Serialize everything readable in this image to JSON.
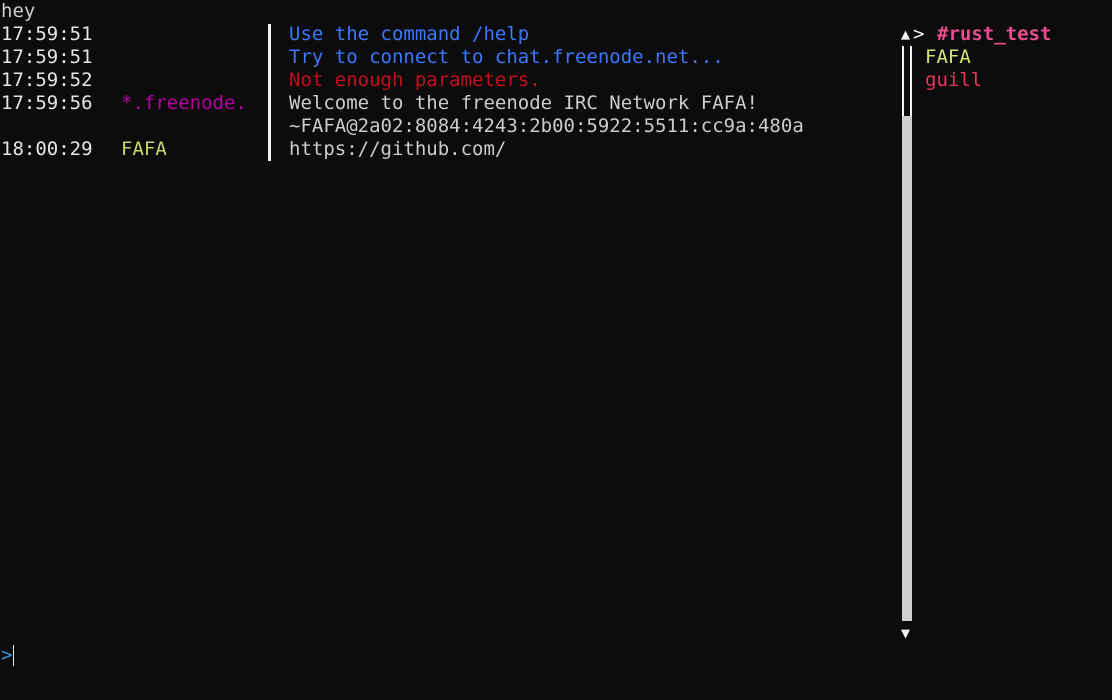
{
  "top_line": "hey",
  "messages": [
    {
      "time": "17:59:51",
      "nick": "",
      "nick_color": "#cccccc",
      "text": "Use the command /help",
      "text_color": "#3b78ff"
    },
    {
      "time": "17:59:51",
      "nick": "",
      "nick_color": "#cccccc",
      "text": "Try to connect to chat.freenode.net...",
      "text_color": "#3b78ff"
    },
    {
      "time": "17:59:52",
      "nick": "",
      "nick_color": "#cccccc",
      "text": "Not enough parameters.",
      "text_color": "#c50f1f"
    },
    {
      "time": "17:59:56",
      "nick": "*.freenode.",
      "nick_color": "#b4009e",
      "text": "Welcome to the freenode IRC Network FAFA!",
      "text_color": "#cccccc"
    },
    {
      "time": "",
      "nick": "",
      "nick_color": "#cccccc",
      "text": "~FAFA@2a02:8084:4243:2b00:5922:5511:cc9a:480a",
      "text_color": "#cccccc"
    },
    {
      "time": "18:00:29",
      "nick": "FAFA",
      "nick_color": "#c8d86a",
      "text": "https://github.com/",
      "text_color": "#cccccc"
    }
  ],
  "channel_panel": {
    "scroll_up_glyph": "▲",
    "selector": ">",
    "channel": "#rust_test",
    "channel_color": "#e74d8a",
    "scroll_down_glyph": "▼",
    "users": [
      {
        "name": "FAFA",
        "color": "#d6e36e"
      },
      {
        "name": "guill",
        "color": "#e8365c"
      }
    ]
  },
  "input": {
    "prompt": ">",
    "prompt_color": "#3a96dd",
    "value": ""
  }
}
